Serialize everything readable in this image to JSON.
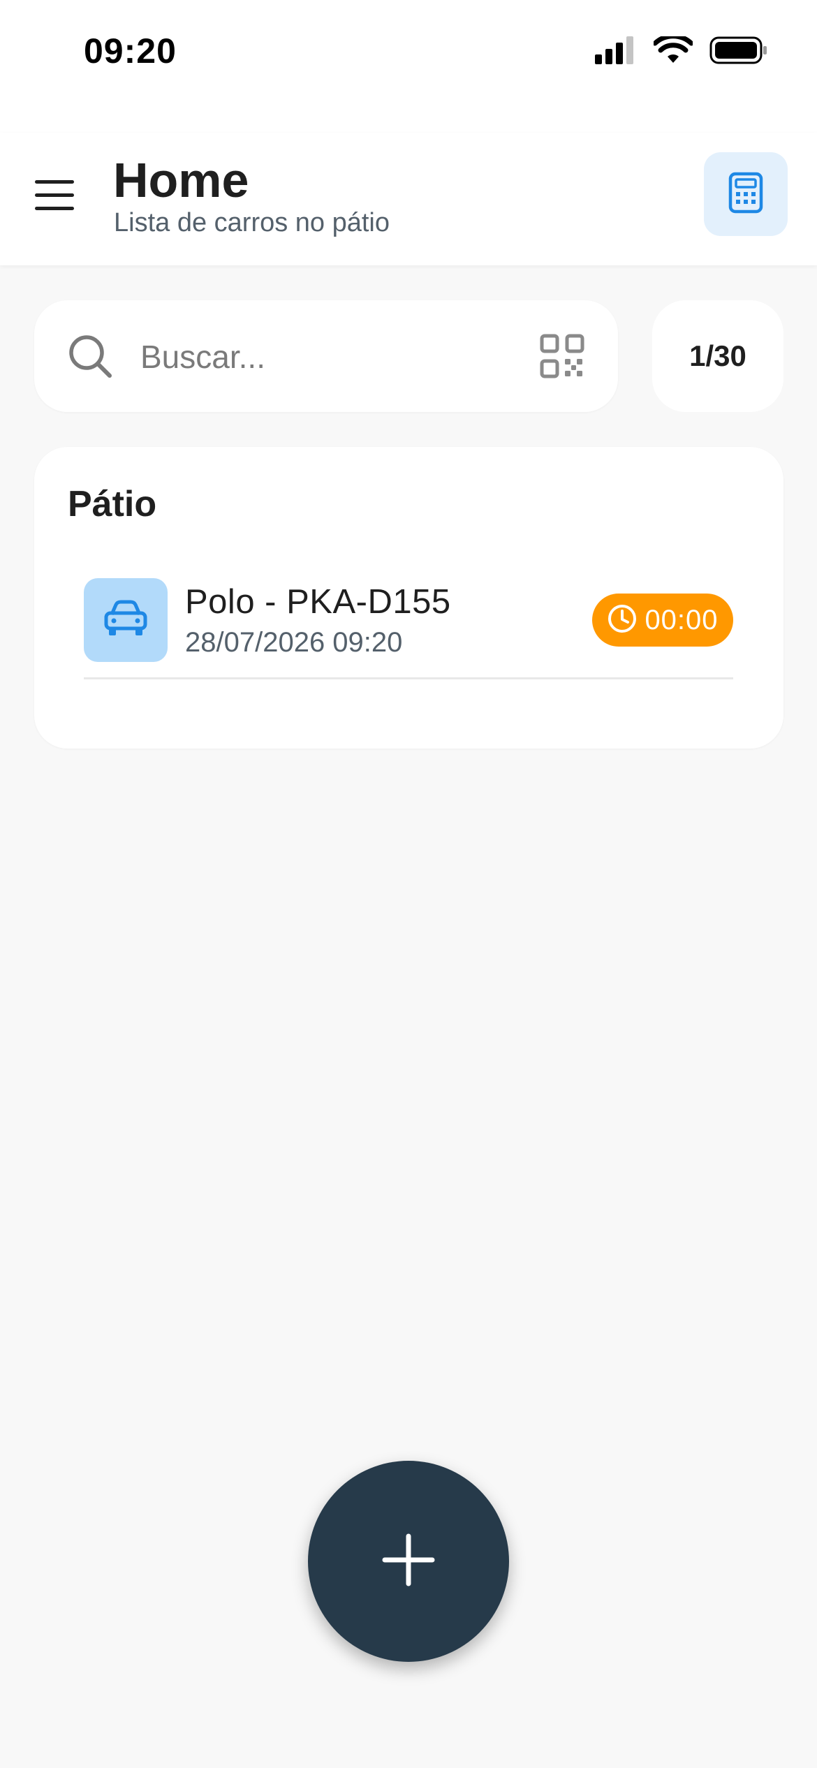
{
  "status_bar": {
    "time": "09:20",
    "icons": [
      "cellular-signal-icon",
      "wifi-icon",
      "battery-icon"
    ]
  },
  "header": {
    "title": "Home",
    "subtitle": "Lista de carros no pátio",
    "menu_icon": "hamburger-menu-icon",
    "action_icon": "calculator-icon"
  },
  "search": {
    "placeholder": "Buscar...",
    "value": "",
    "leading_icon": "search-icon",
    "trailing_icon": "qr-code-icon"
  },
  "counter": {
    "label": "1/30"
  },
  "patio": {
    "title": "Pátio",
    "cars": [
      {
        "name": "Polo - PKA-D155",
        "datetime": "28/07/2026 09:20",
        "elapsed": "00:00",
        "icon": "car-icon"
      }
    ]
  },
  "fab": {
    "icon": "plus-icon"
  },
  "colors": {
    "background": "#f8f8f8",
    "surface": "#ffffff",
    "primary_blue": "#1e88e5",
    "thumb_blue": "#b2dafa",
    "calc_bg": "#e3f0fc",
    "timer_orange": "#ff9800",
    "fab": "#263a4a",
    "text_primary": "#1f1f1f",
    "text_secondary": "#54606b"
  }
}
